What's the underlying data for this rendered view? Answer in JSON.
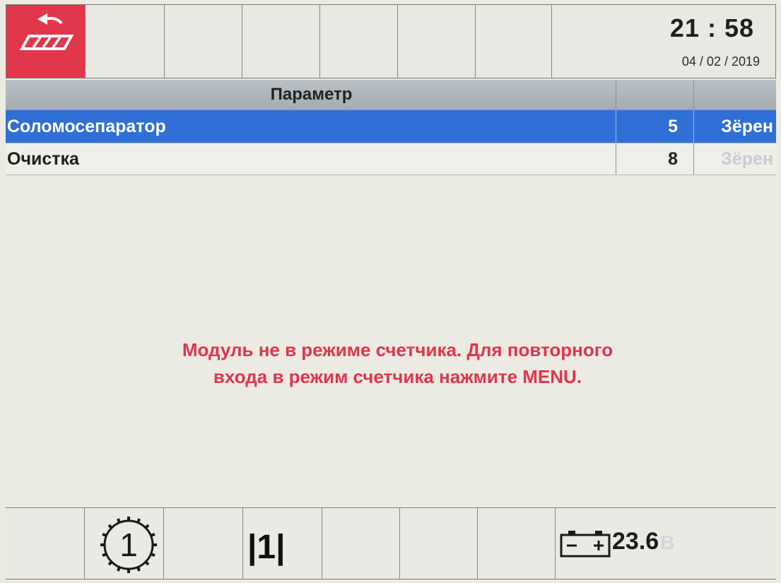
{
  "topbar": {
    "back_icon": "auger-return-icon",
    "time": "21 : 58",
    "date": "04 / 02 / 2019",
    "accent_color": "#e2364a"
  },
  "table": {
    "header": {
      "param": "Параметр",
      "value": "",
      "unit": ""
    },
    "rows": [
      {
        "param": "Соломосепаратор",
        "value": "5",
        "unit": "Зёрен",
        "selected": true
      },
      {
        "param": "Очистка",
        "value": "8",
        "unit": "Зёрен",
        "selected": false
      }
    ],
    "selection_color": "#2f6fd6"
  },
  "message": {
    "line1": "Модуль не в режиме счетчика. Для повторного",
    "line2_prefix": "входа в режим счетчика нажмите ",
    "line2_key": "MENU",
    "line2_suffix": ".",
    "color": "#e0354a"
  },
  "bottombar": {
    "gear_icon": "gear-1-icon",
    "gear_number": "1",
    "track_icon": "track-1-icon",
    "track_label": "|1|",
    "battery_icon": "battery-icon",
    "voltage": "23.6",
    "voltage_unit": "В"
  }
}
